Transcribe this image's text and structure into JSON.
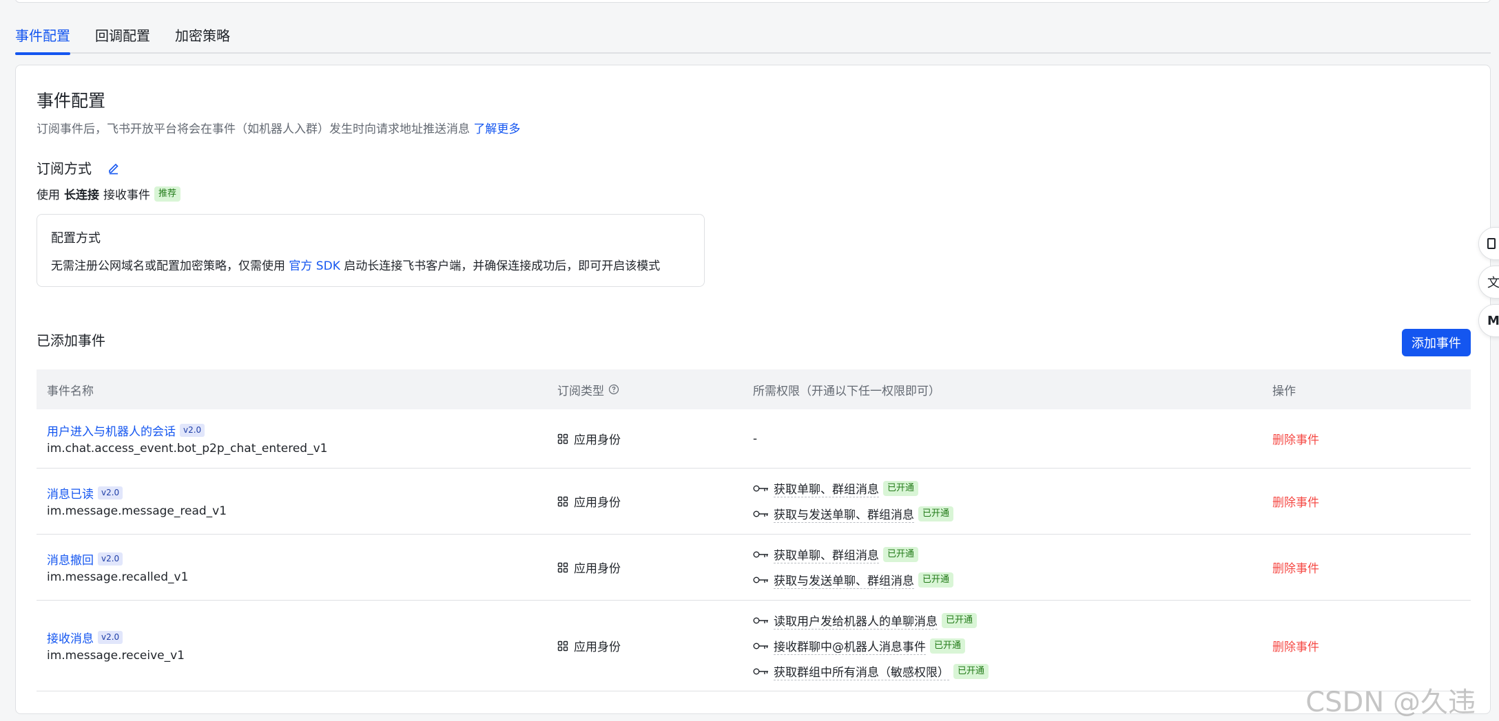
{
  "tabs": [
    {
      "label": "事件配置",
      "active": true
    },
    {
      "label": "回调配置",
      "active": false
    },
    {
      "label": "加密策略",
      "active": false
    }
  ],
  "section": {
    "title": "事件配置",
    "description": "订阅事件后，飞书开放平台将会在事件（如机器人入群）发生时向请求地址推送消息",
    "learn_more": "了解更多"
  },
  "subscription": {
    "label": "订阅方式",
    "use_prefix": "使用",
    "method": "长连接",
    "use_suffix": "接收事件",
    "recommend_tag": "推荐",
    "config_title": "配置方式",
    "config_text_1": "无需注册公网域名或配置加密策略，仅需使用",
    "config_link": "官方 SDK",
    "config_text_2": "启动长连接飞书客户端，并确保连接成功后，即可开启该模式"
  },
  "added": {
    "title": "已添加事件",
    "add_button": "添加事件"
  },
  "table": {
    "headers": [
      "事件名称",
      "订阅类型",
      "所需权限（开通以下任一权限即可）",
      "操作"
    ],
    "rows": [
      {
        "name": "用户进入与机器人的会话",
        "version": "v2.0",
        "key": "im.chat.access_event.bot_p2p_chat_entered_v1",
        "type": "应用身份",
        "permissions_text": "-",
        "permissions": [],
        "action": "删除事件"
      },
      {
        "name": "消息已读",
        "version": "v2.0",
        "key": "im.message.message_read_v1",
        "type": "应用身份",
        "permissions": [
          {
            "name": "获取单聊、群组消息",
            "status": "已开通"
          },
          {
            "name": "获取与发送单聊、群组消息",
            "status": "已开通"
          }
        ],
        "action": "删除事件"
      },
      {
        "name": "消息撤回",
        "version": "v2.0",
        "key": "im.message.recalled_v1",
        "type": "应用身份",
        "permissions": [
          {
            "name": "获取单聊、群组消息",
            "status": "已开通"
          },
          {
            "name": "获取与发送单聊、群组消息",
            "status": "已开通"
          }
        ],
        "action": "删除事件"
      },
      {
        "name": "接收消息",
        "version": "v2.0",
        "key": "im.message.receive_v1",
        "type": "应用身份",
        "permissions": [
          {
            "name": "读取用户发给机器人的单聊消息",
            "status": "已开通"
          },
          {
            "name": "接收群聊中@机器人消息事件",
            "status": "已开通"
          },
          {
            "name": "获取群组中所有消息（敏感权限）",
            "status": "已开通"
          }
        ],
        "action": "删除事件"
      }
    ]
  },
  "side_buttons": [
    "",
    "文",
    "M"
  ],
  "watermark": "CSDN @久违",
  "colors": {
    "primary": "#1456f0",
    "danger": "#f54a45",
    "success_bg": "#d9f5d6",
    "success_text": "#237b19"
  }
}
